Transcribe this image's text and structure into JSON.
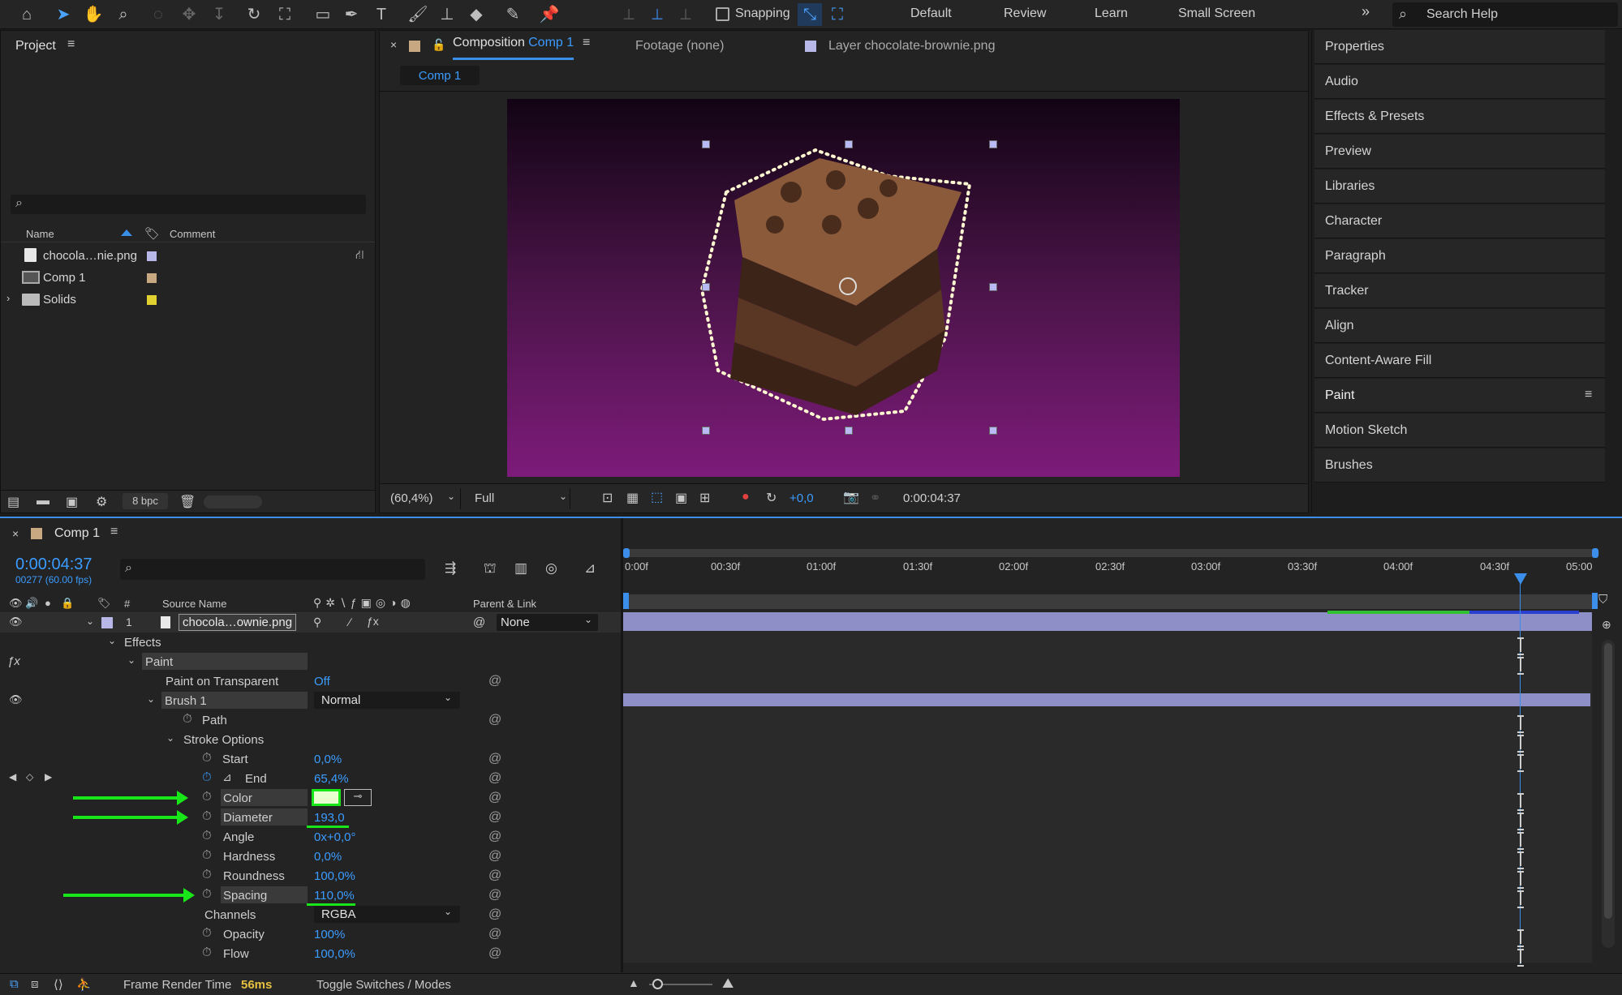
{
  "toolbar": {
    "snapping_label": "Snapping",
    "workspaces": [
      "Default",
      "Review",
      "Learn",
      "Small Screen"
    ],
    "search_placeholder": "Search Help"
  },
  "project": {
    "title": "Project",
    "columns": {
      "name": "Name",
      "comment": "Comment"
    },
    "items": [
      {
        "name": "chocola…nie.png",
        "color": "#b8b8e8"
      },
      {
        "name": "Comp 1",
        "color": "#c8a880"
      },
      {
        "name": "Solids",
        "color": "#e0d030"
      }
    ],
    "bpc": "8 bpc"
  },
  "viewer": {
    "tabs": {
      "composition_prefix": "Composition",
      "composition_name": "Comp 1",
      "footage": "Footage (none)",
      "layer": "Layer chocolate-brownie.png"
    },
    "subtab": "Comp 1",
    "zoom": "(60,4%)",
    "resolution": "Full",
    "exposure": "+0,0",
    "timecode": "0:00:04:37"
  },
  "right_panel": {
    "items": [
      "Properties",
      "Audio",
      "Effects & Presets",
      "Preview",
      "Libraries",
      "Character",
      "Paragraph",
      "Tracker",
      "Align",
      "Content-Aware Fill",
      "Paint",
      "Motion Sketch",
      "Brushes"
    ]
  },
  "timeline": {
    "comp_tab": "Comp 1",
    "current_time": "0:00:04:37",
    "fps_info": "00277 (60.00 fps)",
    "columns": {
      "num": "#",
      "source": "Source Name",
      "parent": "Parent & Link"
    },
    "ruler": [
      "0:00f",
      "00:30f",
      "01:00f",
      "01:30f",
      "02:00f",
      "02:30f",
      "03:00f",
      "03:30f",
      "04:00f",
      "04:30f",
      "05:00"
    ],
    "layer": {
      "index": "1",
      "name": "chocola…ownie.png",
      "parent": "None"
    },
    "props": {
      "effects": "Effects",
      "paint": "Paint",
      "paint_on_transparent": "Paint on Transparent",
      "pot_value": "Off",
      "brush": "Brush 1",
      "blend": "Normal",
      "path": "Path",
      "stroke_options": "Stroke Options",
      "start": "Start",
      "start_v": "0,0%",
      "end": "End",
      "end_v": "65,4%",
      "color": "Color",
      "color_swatch": "#e8ffd0",
      "diameter": "Diameter",
      "diameter_v": "193,0",
      "angle": "Angle",
      "angle_v": "0x+0,0°",
      "hardness": "Hardness",
      "hardness_v": "0,0%",
      "roundness": "Roundness",
      "roundness_v": "100,0%",
      "spacing": "Spacing",
      "spacing_v": "110,0%",
      "channels": "Channels",
      "channels_v": "RGBA",
      "opacity": "Opacity",
      "opacity_v": "100%",
      "flow": "Flow",
      "flow_v": "100,0%"
    },
    "footer": {
      "render_label": "Frame Render Time",
      "render_value": "56ms",
      "toggle": "Toggle Switches / Modes"
    }
  }
}
